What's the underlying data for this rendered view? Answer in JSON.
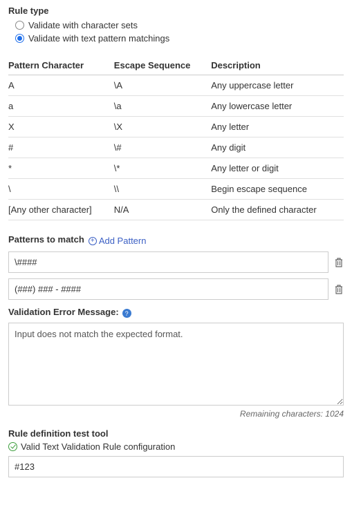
{
  "ruleType": {
    "label": "Rule type",
    "option1": "Validate with character sets",
    "option2": "Validate with text pattern matchings"
  },
  "patternTable": {
    "headers": {
      "c1": "Pattern Character",
      "c2": "Escape Sequence",
      "c3": "Description"
    },
    "rows": [
      {
        "c1": "A",
        "c2": "\\A",
        "c3": "Any uppercase letter"
      },
      {
        "c1": "a",
        "c2": "\\a",
        "c3": "Any lowercase letter"
      },
      {
        "c1": "X",
        "c2": "\\X",
        "c3": "Any letter"
      },
      {
        "c1": "#",
        "c2": "\\#",
        "c3": "Any digit"
      },
      {
        "c1": "*",
        "c2": "\\*",
        "c3": "Any letter or digit"
      },
      {
        "c1": "\\",
        "c2": "\\\\",
        "c3": "Begin escape sequence"
      },
      {
        "c1": "[Any other character]",
        "c2": "N/A",
        "c3": "Only the defined character"
      }
    ]
  },
  "patternsToMatch": {
    "label": "Patterns to match",
    "addLink": "Add Pattern",
    "items": [
      "\\####",
      "(###) ### - ####"
    ]
  },
  "errorMessage": {
    "label": "Validation Error Message:",
    "value": "Input does not match the expected format.",
    "remainingLabel": "Remaining characters: ",
    "remainingCount": "1024"
  },
  "testTool": {
    "label": "Rule definition test tool",
    "status": "Valid Text Validation Rule configuration",
    "value": "#123"
  }
}
